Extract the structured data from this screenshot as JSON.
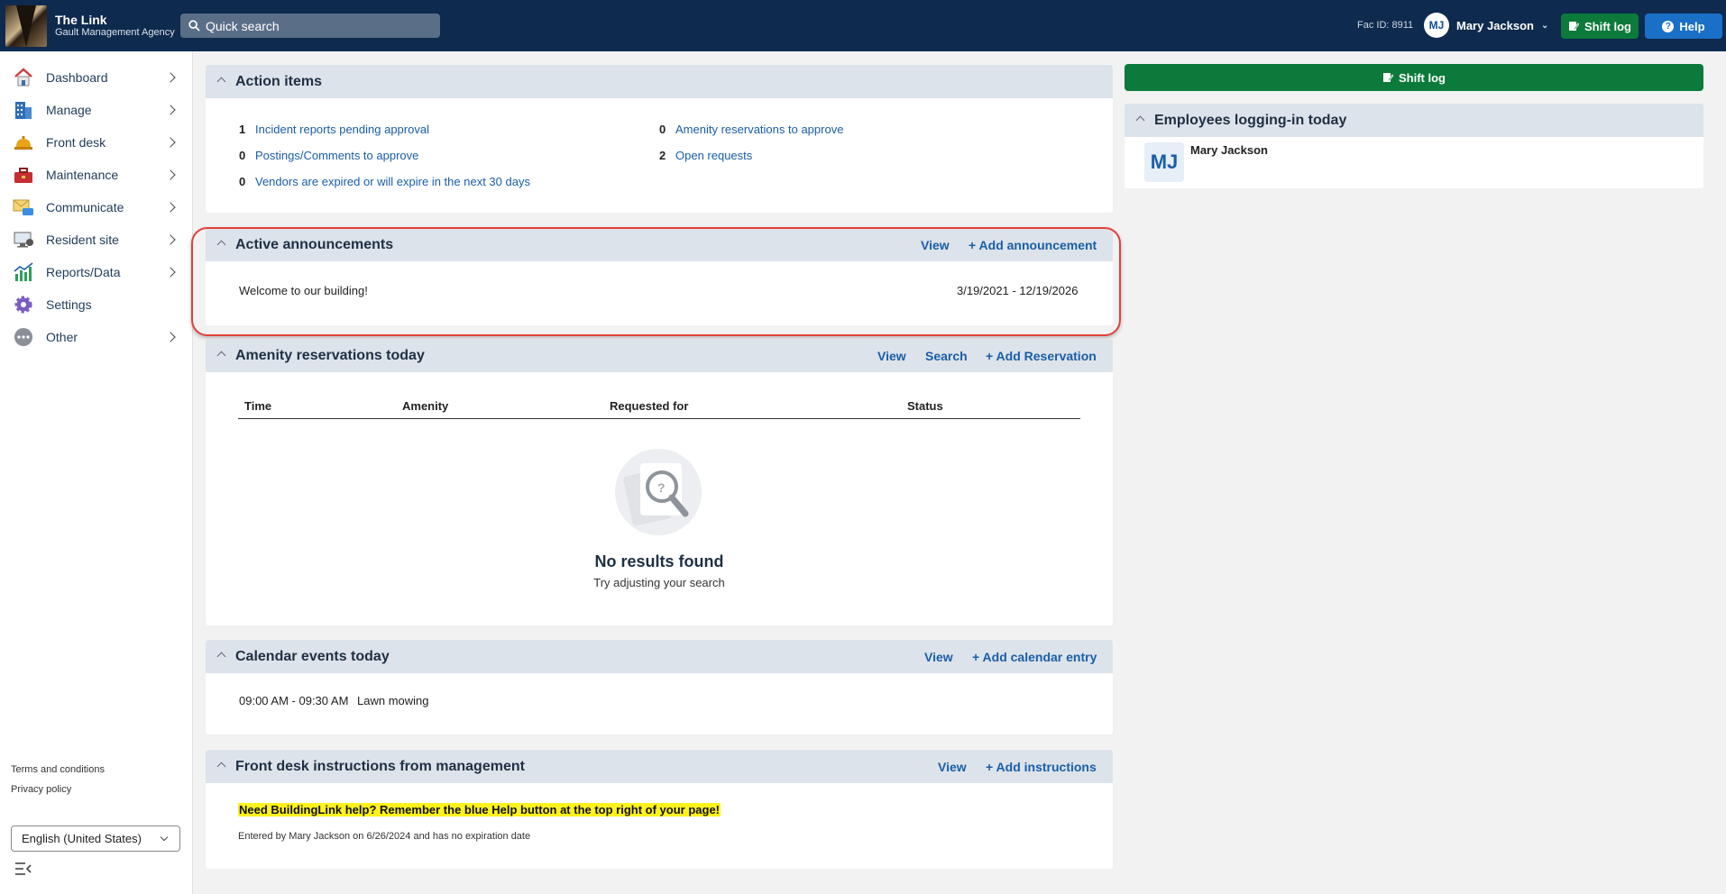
{
  "header": {
    "app_name": "The Link",
    "org_name": "Gault Management Agency",
    "search_placeholder": "Quick search",
    "fac_id": "Fac ID: 8911",
    "user_initials": "MJ",
    "user_name": "Mary Jackson",
    "shift_log_label": "Shift log",
    "help_label": "Help"
  },
  "sidebar": {
    "items": [
      {
        "label": "Dashboard",
        "icon": "dashboard-house-icon"
      },
      {
        "label": "Manage",
        "icon": "building-icon"
      },
      {
        "label": "Front desk",
        "icon": "bell-icon"
      },
      {
        "label": "Maintenance",
        "icon": "toolbox-icon"
      },
      {
        "label": "Communicate",
        "icon": "envelope-icon"
      },
      {
        "label": "Resident site",
        "icon": "monitor-icon"
      },
      {
        "label": "Reports/Data",
        "icon": "chart-icon"
      },
      {
        "label": "Settings",
        "icon": "gear-icon"
      },
      {
        "label": "Other",
        "icon": "more-icon"
      }
    ],
    "terms": "Terms and conditions",
    "privacy": "Privacy policy",
    "language": "English (United States)"
  },
  "action_items": {
    "title": "Action items",
    "left": [
      {
        "count": "1",
        "label": "Incident reports pending approval"
      },
      {
        "count": "0",
        "label": "Postings/Comments to approve"
      },
      {
        "count": "0",
        "label": "Vendors are expired or will expire in the next 30 days"
      }
    ],
    "right": [
      {
        "count": "0",
        "label": "Amenity reservations to approve"
      },
      {
        "count": "2",
        "label": "Open requests"
      }
    ]
  },
  "announcements": {
    "title": "Active announcements",
    "view": "View",
    "add": "+ Add announcement",
    "item_text": "Welcome to our building!",
    "item_dates": "3/19/2021 - 12/19/2026"
  },
  "amenity": {
    "title": "Amenity reservations today",
    "view": "View",
    "search": "Search",
    "add": "+ Add Reservation",
    "columns": [
      "Time",
      "Amenity",
      "Requested for",
      "Status"
    ],
    "empty_title": "No results found",
    "empty_sub": "Try adjusting your search"
  },
  "calendar": {
    "title": "Calendar events today",
    "view": "View",
    "add": "+ Add calendar entry",
    "event_time": "09:00 AM - 09:30 AM",
    "event_name": "Lawn mowing"
  },
  "instructions": {
    "title": "Front desk instructions from management",
    "view": "View",
    "add": "+ Add instructions",
    "message": "Need BuildingLink help? Remember the blue Help button at the top right of your page!",
    "meta": "Entered by Mary Jackson on 6/26/2024 and has no expiration date"
  },
  "right": {
    "shift_log": "Shift log",
    "employees_title": "Employees logging-in today",
    "employee_initials": "MJ",
    "employee_name": "Mary Jackson"
  },
  "colors": {
    "topbar": "#0e2a4e",
    "green": "#0b7a3b",
    "help_blue": "#1a6fc6",
    "link_blue": "#1a5ea8",
    "highlight_red": "#e2403a"
  }
}
